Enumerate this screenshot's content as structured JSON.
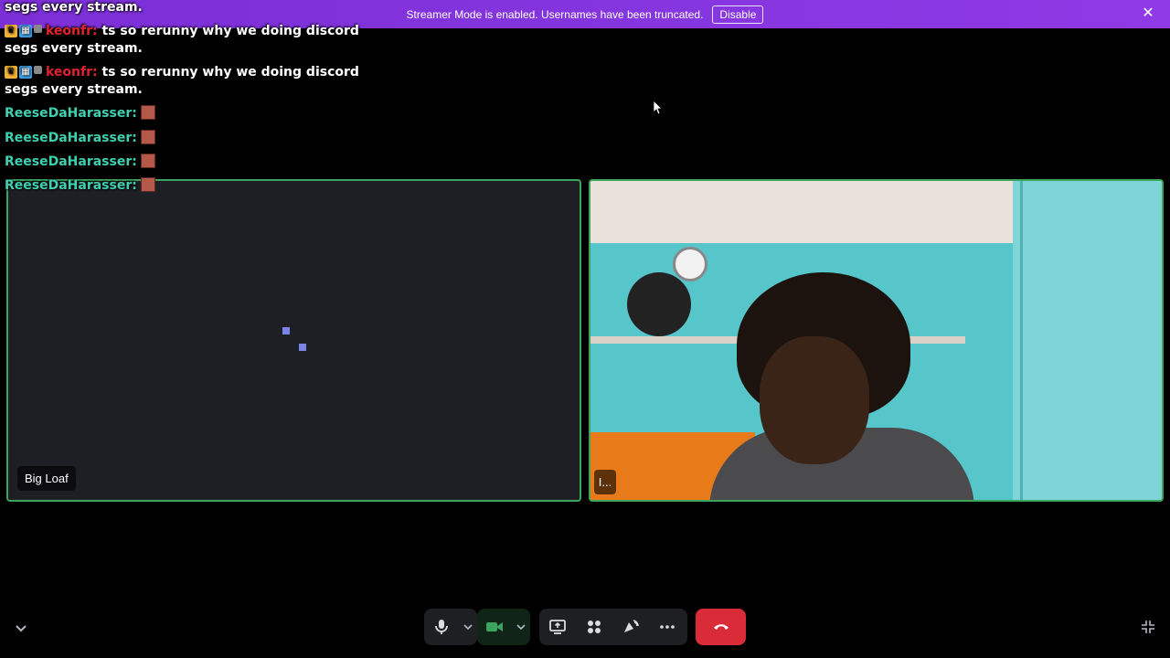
{
  "banner": {
    "text": "Streamer Mode is enabled. Usernames have been truncated.",
    "button_label": "Disable",
    "close_icon": "close-icon"
  },
  "chat": {
    "lines": [
      {
        "type": "text",
        "text": "segs every stream."
      },
      {
        "type": "msg",
        "username": "keonfr:",
        "message": "ts so rerunny why we doing discord"
      },
      {
        "type": "text",
        "text": "segs every stream."
      },
      {
        "type": "msg",
        "username": "keonfr:",
        "message": "ts so rerunny why we doing discord"
      },
      {
        "type": "text",
        "text": "segs every stream."
      },
      {
        "type": "emote",
        "username": "ReeseDaHarasser:"
      },
      {
        "type": "emote",
        "username": "ReeseDaHarasser:"
      },
      {
        "type": "emote",
        "username": "ReeseDaHarasser:"
      },
      {
        "type": "emote",
        "username": "ReeseDaHarasser:"
      }
    ]
  },
  "tiles": {
    "left_label": "Big Loaf",
    "right_label": "I..."
  },
  "controls": {
    "icons": [
      "microphone-icon",
      "chevron-down-icon",
      "camera-icon",
      "chevron-down-icon",
      "screen-share-icon",
      "activities-icon",
      "soundboard-icon",
      "more-icon",
      "hangup-icon"
    ]
  },
  "colors": {
    "banner": "#8a2be2",
    "speaking_border": "#3ba55d",
    "hangup": "#da2b38",
    "username_red": "#e0222e",
    "username_teal": "#3fd0b0"
  }
}
